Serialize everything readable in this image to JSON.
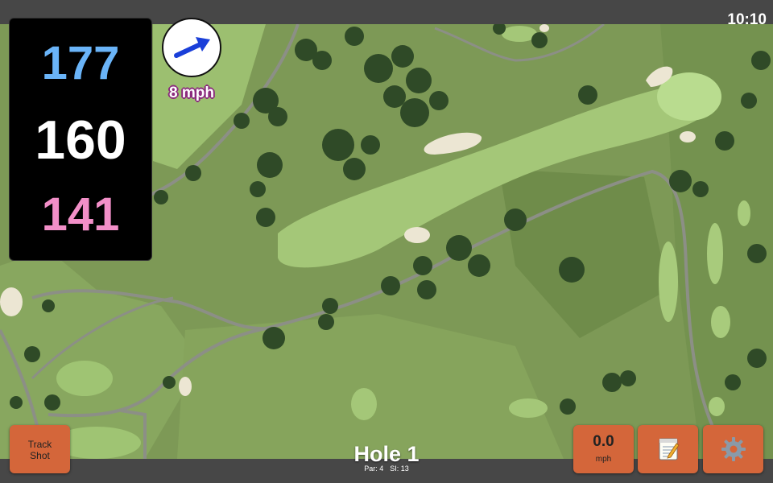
{
  "status_bar": {
    "time": "10:10"
  },
  "distances": {
    "back": "177",
    "middle": "160",
    "front": "141",
    "back_color": "#6ab4f8",
    "middle_color": "#ffffff",
    "front_color": "#f28fc8"
  },
  "wind": {
    "speed_label": "8 mph",
    "arrow_icon": "wind-arrow-icon",
    "arrow_color": "#1a3fd9"
  },
  "buttons": {
    "track_shot": {
      "line1": "Track",
      "line2": "Shot"
    },
    "speed": {
      "value": "0.0",
      "unit": "mph"
    },
    "notes_icon": "notepad-icon",
    "settings_icon": "gear-icon",
    "button_color": "#d4663a"
  },
  "hole": {
    "title": "Hole 1",
    "par_label": "Par: 4",
    "si_label": "SI: 13"
  },
  "map": {
    "type": "satellite aerial view of golf hole"
  }
}
